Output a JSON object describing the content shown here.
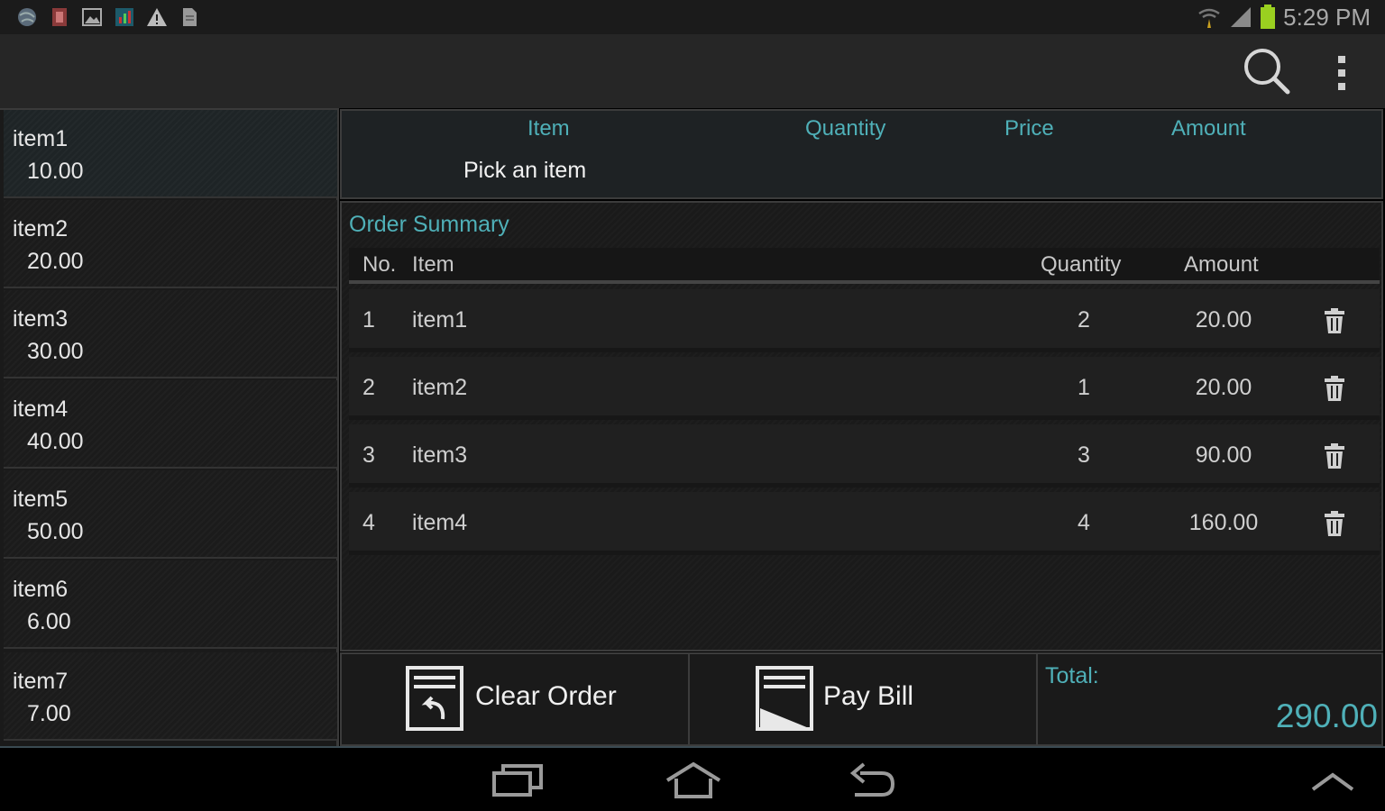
{
  "status_bar": {
    "left_icons": [
      "globe-icon",
      "app-icon",
      "picture-icon",
      "chart-icon",
      "warning-icon",
      "document-icon"
    ],
    "right_icons": [
      "wifi-icon",
      "signal-icon",
      "battery-icon"
    ],
    "time": "5:29 PM"
  },
  "action_bar": {
    "icons": [
      "search-icon",
      "overflow-menu-icon"
    ]
  },
  "menu": {
    "items": [
      {
        "name": "item1",
        "price": "10.00"
      },
      {
        "name": "item2",
        "price": "20.00"
      },
      {
        "name": "item3",
        "price": "30.00"
      },
      {
        "name": "item4",
        "price": "40.00"
      },
      {
        "name": "item5",
        "price": "50.00"
      },
      {
        "name": "item6",
        "price": "6.00"
      },
      {
        "name": "item7",
        "price": "7.00"
      }
    ]
  },
  "current_item": {
    "headers": {
      "item": "Item",
      "quantity": "Quantity",
      "price": "Price",
      "amount": "Amount"
    },
    "placeholder": "Pick an item"
  },
  "summary": {
    "title": "Order Summary",
    "headers": {
      "no": "No.",
      "item": "Item",
      "quantity": "Quantity",
      "amount": "Amount"
    },
    "rows": [
      {
        "no": "1",
        "item": "item1",
        "quantity": "2",
        "amount": "20.00"
      },
      {
        "no": "2",
        "item": "item2",
        "quantity": "1",
        "amount": "20.00"
      },
      {
        "no": "3",
        "item": "item3",
        "quantity": "3",
        "amount": "90.00"
      },
      {
        "no": "4",
        "item": "item4",
        "quantity": "4",
        "amount": "160.00"
      }
    ]
  },
  "actions": {
    "clear_label": "Clear Order",
    "pay_label": "Pay Bill",
    "total_label": "Total:",
    "total_value": "290.00"
  },
  "navigation": {
    "icons": [
      "recent-apps-icon",
      "home-icon",
      "back-icon",
      "chevron-up-icon"
    ]
  },
  "colors": {
    "accent": "#4fb0b8",
    "background": "#1a1a1a"
  }
}
